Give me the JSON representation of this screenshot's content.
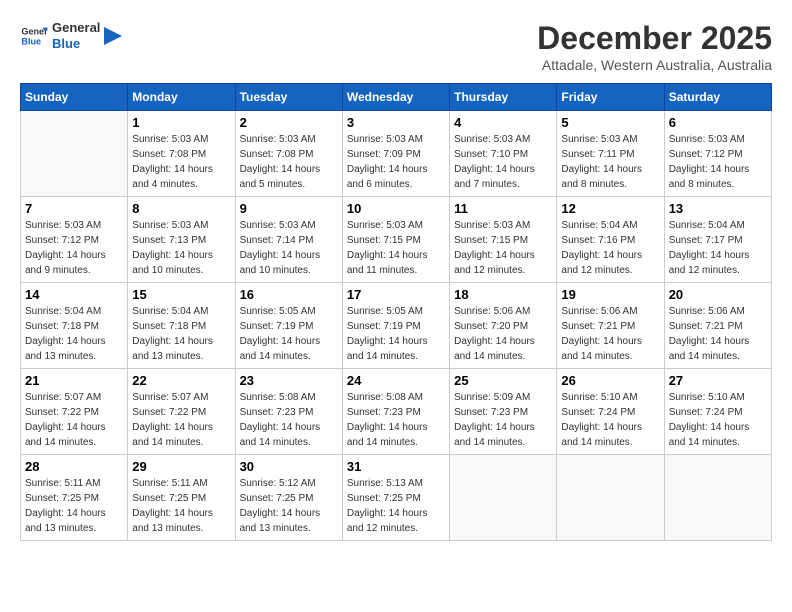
{
  "app": {
    "logo_general": "General",
    "logo_blue": "Blue",
    "month": "December 2025",
    "location": "Attadale, Western Australia, Australia"
  },
  "calendar": {
    "headers": [
      "Sunday",
      "Monday",
      "Tuesday",
      "Wednesday",
      "Thursday",
      "Friday",
      "Saturday"
    ],
    "weeks": [
      [
        {
          "day": "",
          "empty": true
        },
        {
          "day": "1",
          "sunrise": "5:03 AM",
          "sunset": "7:08 PM",
          "daylight": "14 hours and 4 minutes."
        },
        {
          "day": "2",
          "sunrise": "5:03 AM",
          "sunset": "7:08 PM",
          "daylight": "14 hours and 5 minutes."
        },
        {
          "day": "3",
          "sunrise": "5:03 AM",
          "sunset": "7:09 PM",
          "daylight": "14 hours and 6 minutes."
        },
        {
          "day": "4",
          "sunrise": "5:03 AM",
          "sunset": "7:10 PM",
          "daylight": "14 hours and 7 minutes."
        },
        {
          "day": "5",
          "sunrise": "5:03 AM",
          "sunset": "7:11 PM",
          "daylight": "14 hours and 8 minutes."
        },
        {
          "day": "6",
          "sunrise": "5:03 AM",
          "sunset": "7:12 PM",
          "daylight": "14 hours and 8 minutes."
        }
      ],
      [
        {
          "day": "7",
          "sunrise": "5:03 AM",
          "sunset": "7:12 PM",
          "daylight": "14 hours and 9 minutes."
        },
        {
          "day": "8",
          "sunrise": "5:03 AM",
          "sunset": "7:13 PM",
          "daylight": "14 hours and 10 minutes."
        },
        {
          "day": "9",
          "sunrise": "5:03 AM",
          "sunset": "7:14 PM",
          "daylight": "14 hours and 10 minutes."
        },
        {
          "day": "10",
          "sunrise": "5:03 AM",
          "sunset": "7:15 PM",
          "daylight": "14 hours and 11 minutes."
        },
        {
          "day": "11",
          "sunrise": "5:03 AM",
          "sunset": "7:15 PM",
          "daylight": "14 hours and 12 minutes."
        },
        {
          "day": "12",
          "sunrise": "5:04 AM",
          "sunset": "7:16 PM",
          "daylight": "14 hours and 12 minutes."
        },
        {
          "day": "13",
          "sunrise": "5:04 AM",
          "sunset": "7:17 PM",
          "daylight": "14 hours and 12 minutes."
        }
      ],
      [
        {
          "day": "14",
          "sunrise": "5:04 AM",
          "sunset": "7:18 PM",
          "daylight": "14 hours and 13 minutes."
        },
        {
          "day": "15",
          "sunrise": "5:04 AM",
          "sunset": "7:18 PM",
          "daylight": "14 hours and 13 minutes."
        },
        {
          "day": "16",
          "sunrise": "5:05 AM",
          "sunset": "7:19 PM",
          "daylight": "14 hours and 14 minutes."
        },
        {
          "day": "17",
          "sunrise": "5:05 AM",
          "sunset": "7:19 PM",
          "daylight": "14 hours and 14 minutes."
        },
        {
          "day": "18",
          "sunrise": "5:06 AM",
          "sunset": "7:20 PM",
          "daylight": "14 hours and 14 minutes."
        },
        {
          "day": "19",
          "sunrise": "5:06 AM",
          "sunset": "7:21 PM",
          "daylight": "14 hours and 14 minutes."
        },
        {
          "day": "20",
          "sunrise": "5:06 AM",
          "sunset": "7:21 PM",
          "daylight": "14 hours and 14 minutes."
        }
      ],
      [
        {
          "day": "21",
          "sunrise": "5:07 AM",
          "sunset": "7:22 PM",
          "daylight": "14 hours and 14 minutes."
        },
        {
          "day": "22",
          "sunrise": "5:07 AM",
          "sunset": "7:22 PM",
          "daylight": "14 hours and 14 minutes."
        },
        {
          "day": "23",
          "sunrise": "5:08 AM",
          "sunset": "7:23 PM",
          "daylight": "14 hours and 14 minutes."
        },
        {
          "day": "24",
          "sunrise": "5:08 AM",
          "sunset": "7:23 PM",
          "daylight": "14 hours and 14 minutes."
        },
        {
          "day": "25",
          "sunrise": "5:09 AM",
          "sunset": "7:23 PM",
          "daylight": "14 hours and 14 minutes."
        },
        {
          "day": "26",
          "sunrise": "5:10 AM",
          "sunset": "7:24 PM",
          "daylight": "14 hours and 14 minutes."
        },
        {
          "day": "27",
          "sunrise": "5:10 AM",
          "sunset": "7:24 PM",
          "daylight": "14 hours and 14 minutes."
        }
      ],
      [
        {
          "day": "28",
          "sunrise": "5:11 AM",
          "sunset": "7:25 PM",
          "daylight": "14 hours and 13 minutes."
        },
        {
          "day": "29",
          "sunrise": "5:11 AM",
          "sunset": "7:25 PM",
          "daylight": "14 hours and 13 minutes."
        },
        {
          "day": "30",
          "sunrise": "5:12 AM",
          "sunset": "7:25 PM",
          "daylight": "14 hours and 13 minutes."
        },
        {
          "day": "31",
          "sunrise": "5:13 AM",
          "sunset": "7:25 PM",
          "daylight": "14 hours and 12 minutes."
        },
        {
          "day": "",
          "empty": true
        },
        {
          "day": "",
          "empty": true
        },
        {
          "day": "",
          "empty": true
        }
      ]
    ]
  }
}
